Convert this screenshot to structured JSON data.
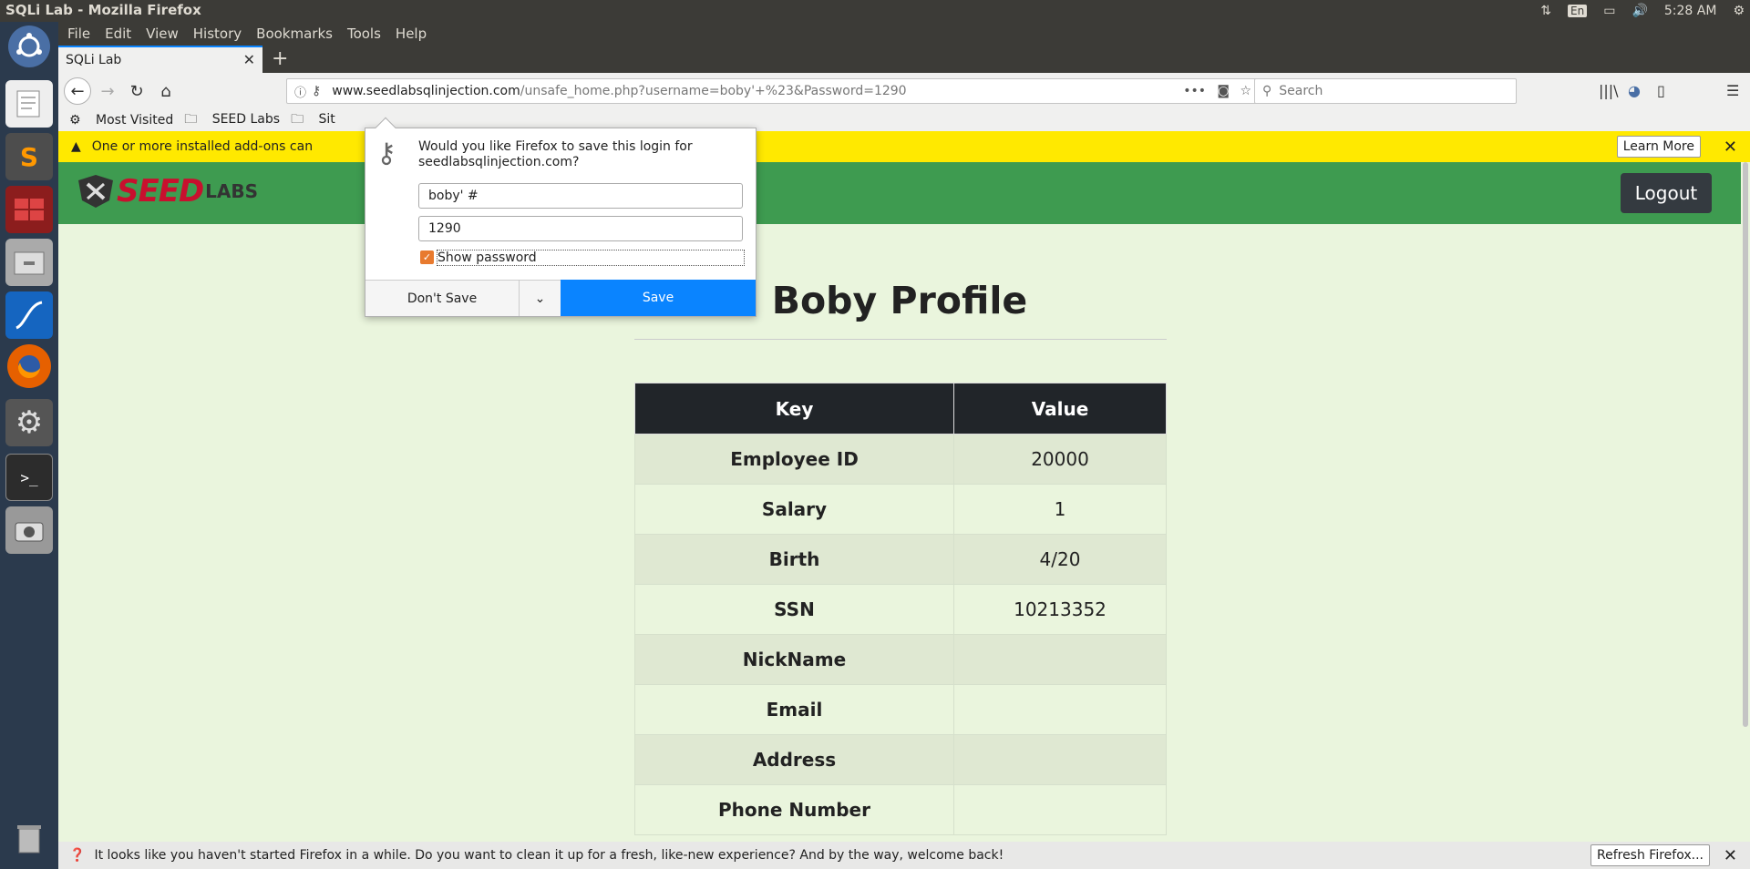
{
  "window": {
    "title": "SQLi Lab - Mozilla Firefox"
  },
  "tray": {
    "lang": "En",
    "time": "5:28 AM"
  },
  "menubar": [
    "File",
    "Edit",
    "View",
    "History",
    "Bookmarks",
    "Tools",
    "Help"
  ],
  "tab": {
    "title": "SQLi Lab"
  },
  "url": {
    "host": "www.seedlabsqlinjection.com",
    "path": "/unsafe_home.php?username=boby'+%23&Password=1290"
  },
  "search": {
    "placeholder": "Search"
  },
  "bookmarks": [
    "Most Visited",
    "SEED Labs",
    "Sit"
  ],
  "addon_bar": {
    "text": "One or more installed add-ons can",
    "learn_more": "Learn More"
  },
  "popup": {
    "message_line1": "Would you like Firefox to save this login for",
    "message_line2": "seedlabsqlinjection.com?",
    "username": "boby' #",
    "password": "1290",
    "show_password": "Show password",
    "dont_save": "Don't Save",
    "save": "Save"
  },
  "site": {
    "logo_seed": "SEED",
    "logo_labs": "LABS",
    "logout": "Logout",
    "profile_title": "Boby Profile",
    "table_headers": [
      "Key",
      "Value"
    ],
    "rows": [
      {
        "key": "Employee ID",
        "value": "20000"
      },
      {
        "key": "Salary",
        "value": "1"
      },
      {
        "key": "Birth",
        "value": "4/20"
      },
      {
        "key": "SSN",
        "value": "10213352"
      },
      {
        "key": "NickName",
        "value": ""
      },
      {
        "key": "Email",
        "value": ""
      },
      {
        "key": "Address",
        "value": ""
      },
      {
        "key": "Phone Number",
        "value": ""
      }
    ]
  },
  "notification": {
    "text": "It looks like you haven't started Firefox in a while. Do you want to clean it up for a fresh, like-new experience? And by the way, welcome back!",
    "refresh": "Refresh Firefox..."
  },
  "colors": {
    "launcher": "#2b3a4d",
    "site_header": "#3e9b50",
    "page_bg": "#eaf5dd",
    "save_button": "#0a84ff",
    "addon_bar": "#ffe900"
  }
}
